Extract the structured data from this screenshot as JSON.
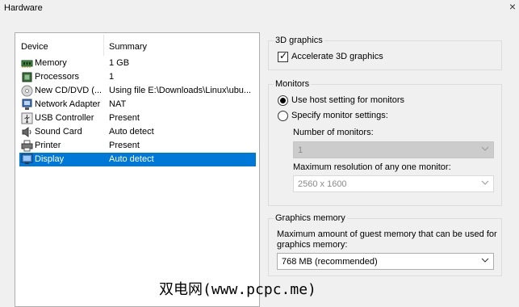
{
  "window": {
    "title": "Hardware",
    "close": "×"
  },
  "device_list": {
    "columns": {
      "device": "Device",
      "summary": "Summary"
    },
    "rows": [
      {
        "name": "Memory",
        "summary": "1 GB",
        "icon": "memory-icon"
      },
      {
        "name": "Processors",
        "summary": "1",
        "icon": "processor-icon"
      },
      {
        "name": "New CD/DVD (...",
        "summary": "Using file E:\\Downloads\\Linux\\ubu...",
        "icon": "cd-dvd-icon"
      },
      {
        "name": "Network Adapter",
        "summary": "NAT",
        "icon": "network-icon"
      },
      {
        "name": "USB Controller",
        "summary": "Present",
        "icon": "usb-icon"
      },
      {
        "name": "Sound Card",
        "summary": "Auto detect",
        "icon": "sound-icon"
      },
      {
        "name": "Printer",
        "summary": "Present",
        "icon": "printer-icon"
      },
      {
        "name": "Display",
        "summary": "Auto detect",
        "icon": "display-icon",
        "selected": true
      }
    ]
  },
  "graphics3d": {
    "legend": "3D graphics",
    "accelerate_label": "Accelerate 3D graphics",
    "accelerate_checked": true
  },
  "monitors": {
    "legend": "Monitors",
    "use_host_label": "Use host setting for monitors",
    "specify_label": "Specify monitor settings:",
    "selected": "use_host",
    "number_label": "Number of monitors:",
    "number_value": "1",
    "max_res_label": "Maximum resolution of any one monitor:",
    "max_res_value": "2560 x 1600"
  },
  "graphics_memory": {
    "legend": "Graphics memory",
    "description": "Maximum amount of guest memory that can be used for graphics memory:",
    "value": "768 MB (recommended)"
  },
  "watermark": "双电网(www.pcpc.me)",
  "colors": {
    "selection": "#0078d7",
    "window_bg": "#f0f0f0"
  }
}
